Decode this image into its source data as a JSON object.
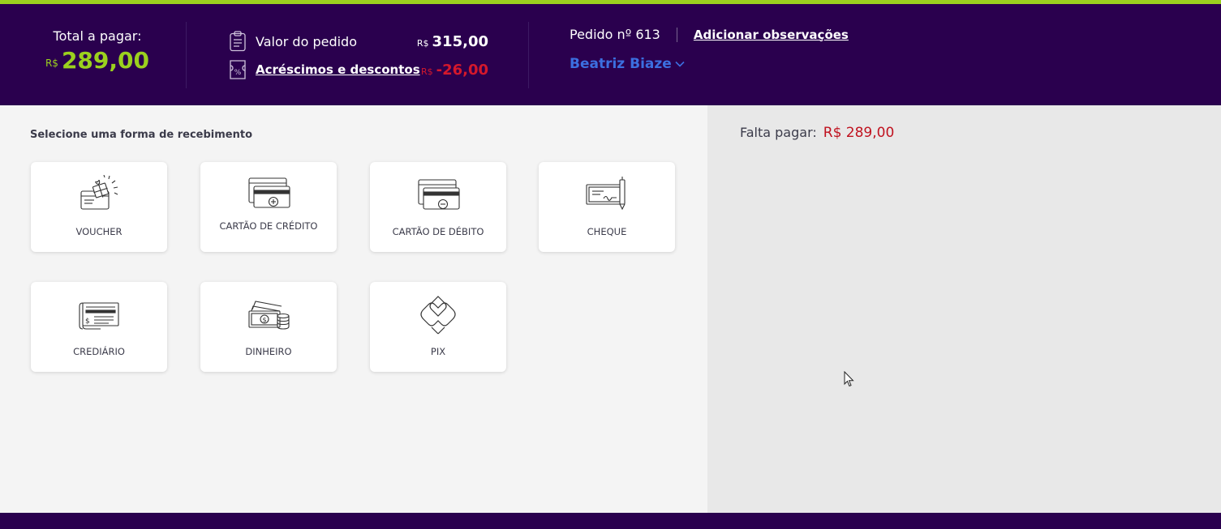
{
  "header": {
    "total_label": "Total a pagar:",
    "currency": "R$",
    "total_value": "289,00",
    "order_value_label": "Valor do pedido",
    "order_value": "315,00",
    "adjustments_label": "Acréscimos e descontos",
    "adjustments_value": "-26,00",
    "order_number": "Pedido nº 613",
    "add_notes": "Adicionar observações",
    "customer": "Beatriz Biaze"
  },
  "main": {
    "section_title": "Selecione uma forma de recebimento",
    "methods": [
      {
        "label": "VOUCHER",
        "icon": "voucher-gift-icon"
      },
      {
        "label": "CARTÃO DE CRÉDITO",
        "icon": "credit-card-plus-icon"
      },
      {
        "label": "CARTÃO DE DÉBITO",
        "icon": "debit-card-minus-icon"
      },
      {
        "label": "CHEQUE",
        "icon": "cheque-pen-icon"
      },
      {
        "label": "CREDIÁRIO",
        "icon": "credit-scroll-icon"
      },
      {
        "label": "DINHEIRO",
        "icon": "cash-coins-icon"
      },
      {
        "label": "PIX",
        "icon": "pix-icon"
      }
    ]
  },
  "summary": {
    "remaining_label": "Falta pagar:",
    "remaining_value": "R$ 289,00"
  },
  "colors": {
    "header_bg": "#2a004e",
    "accent_green": "#9bd11e",
    "negative_red": "#d4182c",
    "link_blue": "#3c6fe0"
  }
}
